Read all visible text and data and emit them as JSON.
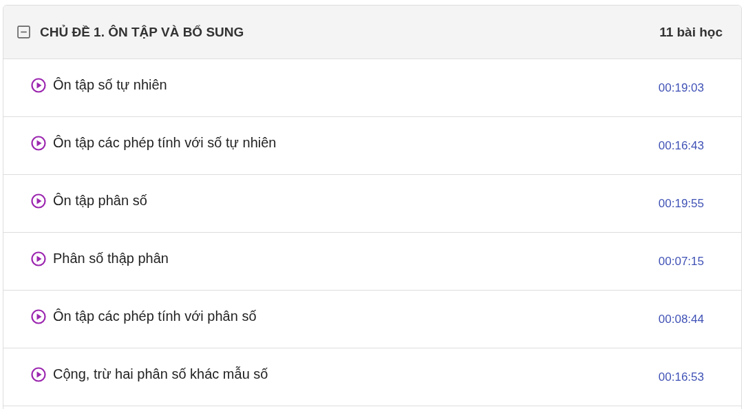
{
  "section": {
    "title": "CHỦ ĐỀ 1. ÔN TẬP VÀ BỔ SUNG",
    "lesson_count": "11 bài học",
    "expanded": true,
    "lessons": [
      {
        "title": "Ôn tập số tự nhiên",
        "duration": "00:19:03"
      },
      {
        "title": "Ôn tập các phép tính với số tự nhiên",
        "duration": "00:16:43"
      },
      {
        "title": "Ôn tập phân số",
        "duration": "00:19:55"
      },
      {
        "title": "Phân số thập phân",
        "duration": "00:07:15"
      },
      {
        "title": "Ôn tập các phép tính với phân số",
        "duration": "00:08:44"
      },
      {
        "title": "Cộng, trừ hai phân số khác mẫu số",
        "duration": "00:16:53"
      }
    ]
  }
}
